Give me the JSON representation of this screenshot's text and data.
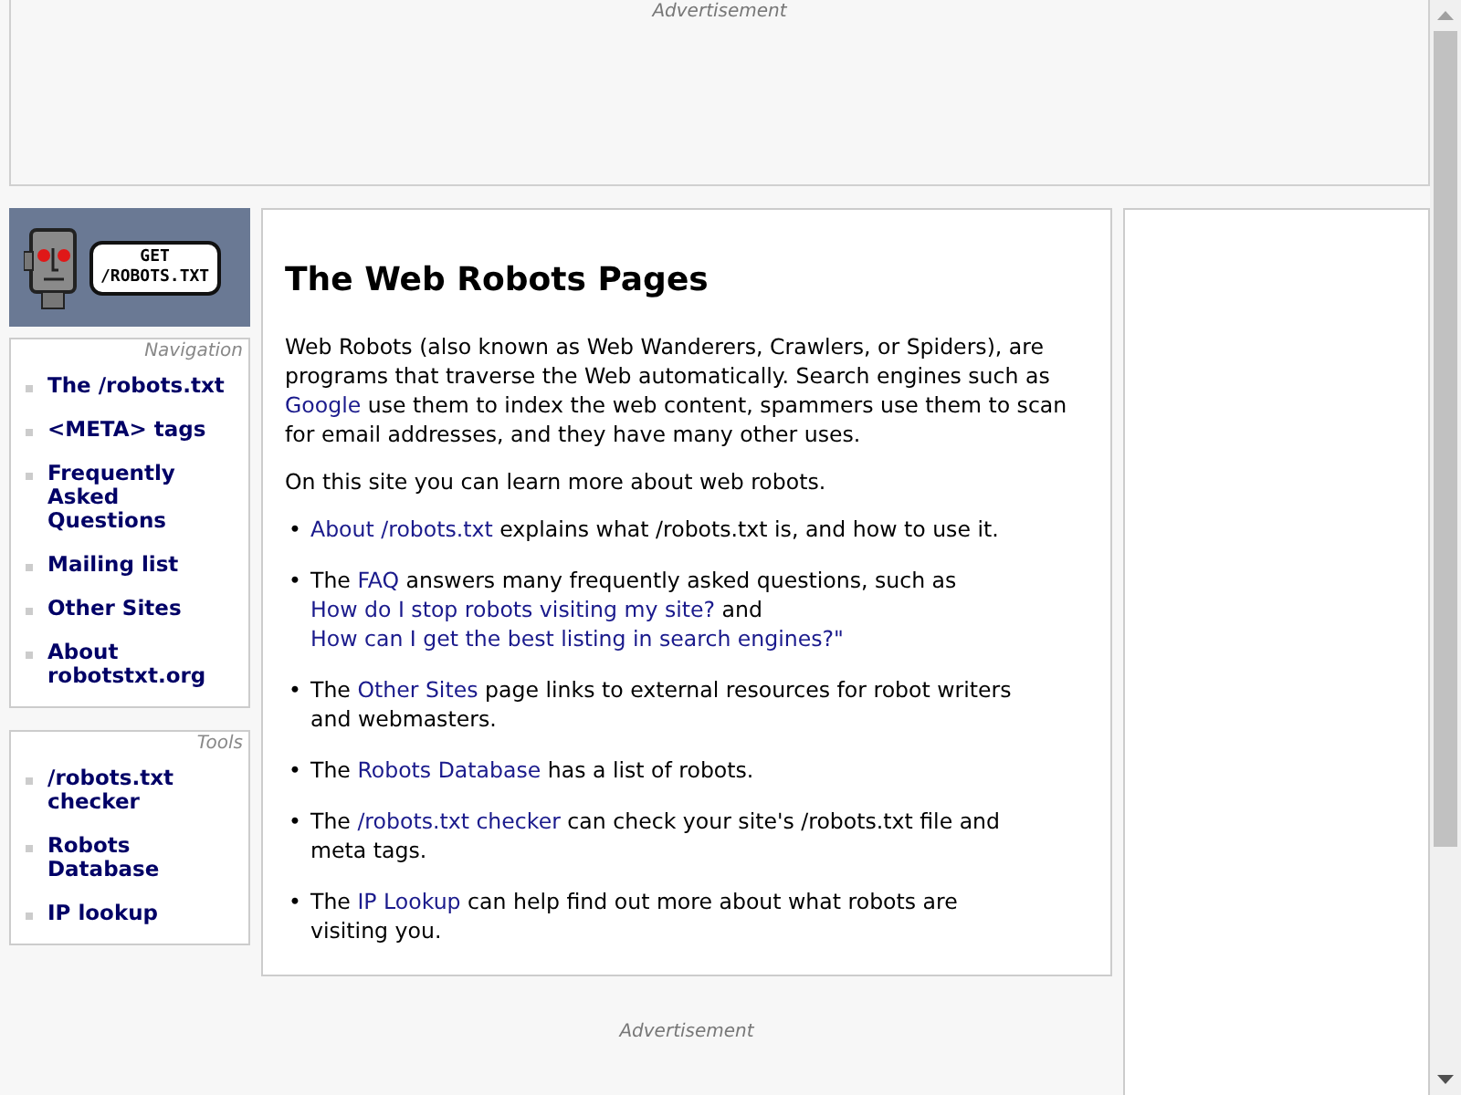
{
  "top_ad": {
    "label": "Advertisement"
  },
  "logo": {
    "lines": [
      "GET",
      "/ROBOTS.TXT"
    ]
  },
  "sidebar": [
    {
      "title": "Navigation",
      "items": [
        "The /robots.txt",
        "<META> tags",
        "Frequently Asked Questions",
        "Mailing list",
        "Other Sites",
        "About robotstxt.org"
      ]
    },
    {
      "title": "Tools",
      "items": [
        "/robots.txt checker",
        "Robots Database",
        "IP lookup"
      ]
    }
  ],
  "main": {
    "title": "The Web Robots Pages",
    "paragraphs": [
      [
        {
          "text": "Web Robots (also known as Web Wanderers, Crawlers, or Spiders), are programs that traverse the Web automatically. Search engines such as ",
          "link": false
        },
        {
          "text": "Google",
          "link": true
        },
        {
          "text": " use them to index the web content, spammers use them to scan for email addresses, and they have many other uses.",
          "link": false
        }
      ],
      [
        {
          "text": "On this site you can learn more about web robots.",
          "link": false
        }
      ]
    ],
    "bullet_marker": "•",
    "bullets": [
      [
        {
          "text": "About /robots.txt",
          "link": true
        },
        {
          "text": " explains what /robots.txt is, and how to use it.",
          "link": false
        }
      ],
      [
        {
          "text": "The ",
          "link": false
        },
        {
          "text": "FAQ",
          "link": true
        },
        {
          "text": " answers many frequently asked questions, such as ",
          "link": false
        },
        {
          "text": "How do I stop robots visiting my site?",
          "link": true
        },
        {
          "text": " and ",
          "link": false
        },
        {
          "text": "How can I get the best listing in search engines?\"",
          "link": true
        }
      ],
      [
        {
          "text": "The ",
          "link": false
        },
        {
          "text": "Other Sites",
          "link": true
        },
        {
          "text": " page links to external resources for robot writers and webmasters.",
          "link": false
        }
      ],
      [
        {
          "text": "The ",
          "link": false
        },
        {
          "text": "Robots Database",
          "link": true
        },
        {
          "text": " has a list of robots.",
          "link": false
        }
      ],
      [
        {
          "text": "The ",
          "link": false
        },
        {
          "text": "/robots.txt checker",
          "link": true
        },
        {
          "text": " can check your site's /robots.txt file and meta tags.",
          "link": false
        }
      ],
      [
        {
          "text": "The ",
          "link": false
        },
        {
          "text": "IP Lookup",
          "link": true
        },
        {
          "text": " can help find out more about what robots are visiting you.",
          "link": false
        }
      ]
    ]
  },
  "bottom_ad": {
    "label": "Advertisement"
  }
}
